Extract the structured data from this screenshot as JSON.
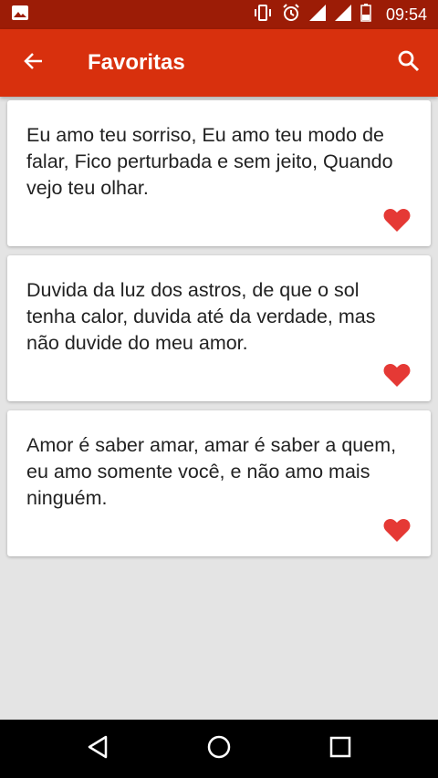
{
  "status_bar": {
    "time": "09:54",
    "icons": [
      "image-icon",
      "vibrate-icon",
      "alarm-icon",
      "signal-icon",
      "signal-icon",
      "battery-icon"
    ]
  },
  "app_bar": {
    "title": "Favoritas",
    "back_icon": "arrow-back-icon",
    "search_icon": "search-icon",
    "color": "#d8300d"
  },
  "cards": [
    {
      "text": "Eu amo teu sorriso, Eu amo teu modo de falar, Fico perturbada e sem jeito, Quando vejo teu olhar.",
      "favorite_icon": "heart-icon"
    },
    {
      "text": "Duvida da luz dos astros, de que o sol tenha calor, duvida até da verdade, mas não duvide do meu amor.",
      "favorite_icon": "heart-icon"
    },
    {
      "text": "Amor é saber amar, amar é saber a quem, eu amo somente você, e não amo mais ninguém.",
      "favorite_icon": "heart-icon"
    }
  ],
  "colors": {
    "status_bar": "#9c1c06",
    "heart": "#e53935",
    "background": "#e4e4e4"
  },
  "nav_bar": {
    "buttons": [
      "back-triangle-icon",
      "home-circle-icon",
      "recents-square-icon"
    ]
  }
}
